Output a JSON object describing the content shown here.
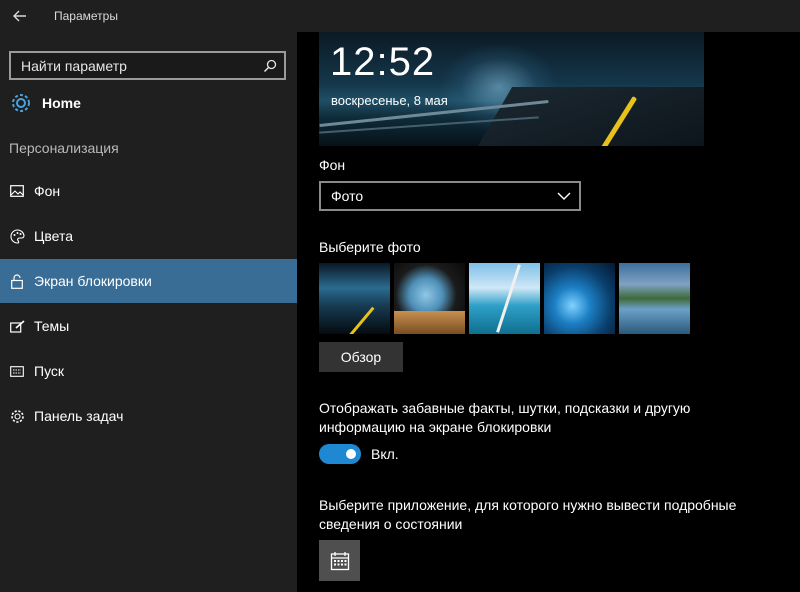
{
  "window": {
    "title": "Параметры"
  },
  "sidebar": {
    "search_placeholder": "Найти параметр",
    "home_label": "Home",
    "section_title": "Персонализация",
    "items": [
      {
        "label": "Фон",
        "icon": "picture-icon",
        "active": false
      },
      {
        "label": "Цвета",
        "icon": "palette-icon",
        "active": false
      },
      {
        "label": "Экран блокировки",
        "icon": "lock-icon",
        "active": true
      },
      {
        "label": "Темы",
        "icon": "brush-icon",
        "active": false
      },
      {
        "label": "Пуск",
        "icon": "start-icon",
        "active": false
      },
      {
        "label": "Панель задач",
        "icon": "gear-icon",
        "active": false
      }
    ]
  },
  "main": {
    "preview": {
      "time": "12:52",
      "date": "воскресенье, 8 мая"
    },
    "background": {
      "label": "Фон",
      "selected": "Фото"
    },
    "choose_photo": {
      "label": "Выберите фото",
      "thumbnails": [
        "night-road",
        "beach-cave",
        "lake-kayak",
        "ice-cave",
        "mountain-lake"
      ],
      "browse_label": "Обзор"
    },
    "fun_facts": {
      "text": "Отображать забавные факты, шутки, подсказки и другую информацию на экране блокировки",
      "toggle_state": "Вкл.",
      "toggle_on": true,
      "accent": "#1e88d3"
    },
    "detailed_status": {
      "text": "Выберите приложение, для которого нужно вывести подробные сведения о состоянии",
      "app_icon": "calendar-icon"
    }
  },
  "colors": {
    "sidebar_bg": "#1f1f1f",
    "active_item": "#3a6d96",
    "toggle_accent": "#1e88d3"
  }
}
